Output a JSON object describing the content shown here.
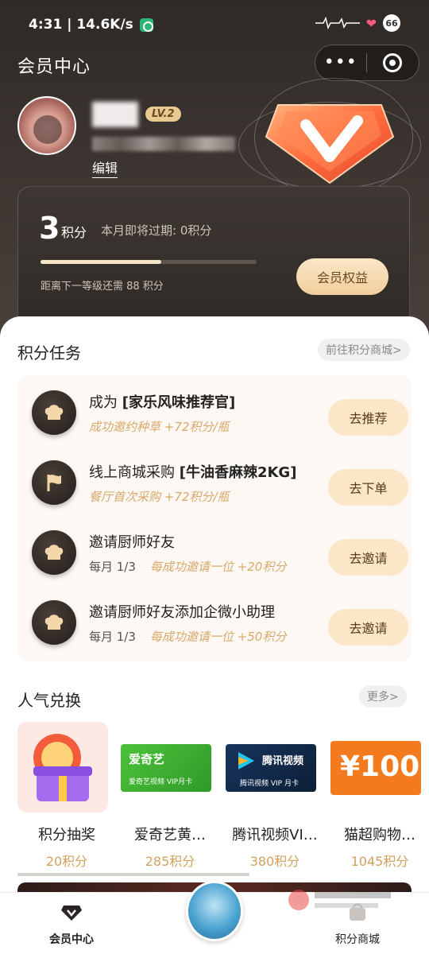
{
  "status_bar": {
    "time_speed": "4:31 | 14.6K/s",
    "battery": "66"
  },
  "header": {
    "title": "会员中心",
    "more": "•••"
  },
  "profile": {
    "level": "LV.2",
    "edit": "编辑"
  },
  "points_card": {
    "points": "3",
    "unit": "积分",
    "expire": "本月即将过期: 0积分",
    "progress_fraction": 0.56,
    "progress_text": "距离下一等级还需 88 积分",
    "benefit_button": "会员权益"
  },
  "tasks_section": {
    "title": "积分任务",
    "link": "前往积分商城>"
  },
  "tasks": [
    {
      "title_prefix": "成为 ",
      "title_bold": "[家乐风味推荐官]",
      "frequency": "",
      "reward": "成功邀约种草 +72积分/瓶",
      "button": "去推荐",
      "icon": "chef-hat-icon"
    },
    {
      "title_prefix": "线上商城采购 ",
      "title_bold": "[牛油香麻辣2KG]",
      "frequency": "",
      "reward": "餐厅首次采购 +72积分/瓶",
      "button": "去下单",
      "icon": "flag-icon"
    },
    {
      "title_prefix": "邀请厨师好友",
      "title_bold": "",
      "frequency": "每月 1/3",
      "reward": "每成功邀请一位 +20积分",
      "button": "去邀请",
      "icon": "chef-hat-icon"
    },
    {
      "title_prefix": "邀请厨师好友添加企微小助理",
      "title_bold": "",
      "frequency": "每月 1/3",
      "reward": "每成功邀请一位 +50积分",
      "button": "去邀请",
      "icon": "chef-hat-icon"
    }
  ],
  "popular_section": {
    "title": "人气兑换",
    "link": "更多>"
  },
  "products": [
    {
      "name": "积分抽奖",
      "points": "20积分",
      "art": "lottery-gift-icon"
    },
    {
      "name": "爱奇艺黄…",
      "points": "285积分",
      "art": "iqiyi-card",
      "brand": "爱奇艺",
      "caption": "爱奇艺视频 VIP月卡"
    },
    {
      "name": "腾讯视频VI…",
      "points": "380积分",
      "art": "tencent-video-card",
      "brand": "腾讯视频",
      "caption": "腾讯视频 VIP 月卡"
    },
    {
      "name": "猫超购物…",
      "points": "1045积分",
      "art": "tmall-card",
      "brand": "¥100"
    }
  ],
  "tabbar": {
    "member": "会员中心",
    "mall": "积分商城"
  },
  "colors": {
    "accent": "#f0cf9d",
    "reward_text": "#d8a96a",
    "dark_bg": "#2f2a27"
  }
}
